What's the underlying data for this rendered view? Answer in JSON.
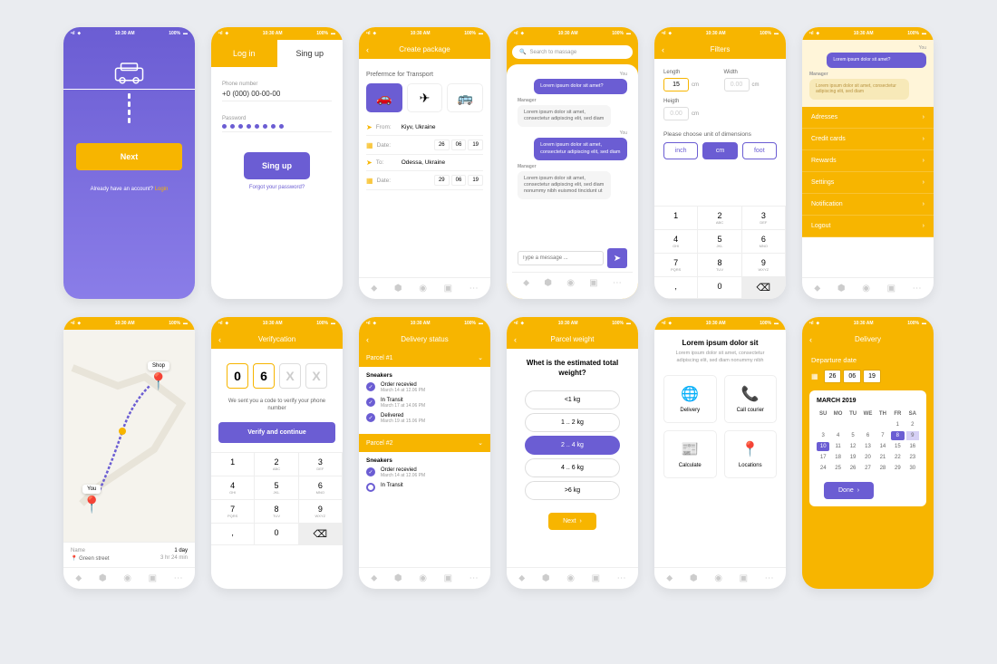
{
  "status": {
    "time": "10:30 AM",
    "battery": "100%"
  },
  "s1": {
    "next": "Next",
    "already": "Already have an account?",
    "login": "Login"
  },
  "s2": {
    "login": "Log in",
    "signup": "Sing up",
    "phone_lbl": "Phone number",
    "phone_val": "+0 (000) 00-00-00",
    "pass_lbl": "Password",
    "btn": "Sing up",
    "forgot": "Forgot your password?"
  },
  "s3": {
    "title": "Create package",
    "pref": "Prefermce for Transport",
    "from_lbl": "From:",
    "from_val": "Kiyv, Ukraine",
    "date_lbl": "Date:",
    "d1": [
      "26",
      "06",
      "19"
    ],
    "to_lbl": "To:",
    "to_val": "Odessa, Ukraine",
    "d2": [
      "29",
      "06",
      "19"
    ]
  },
  "s4": {
    "search_ph": "Search to massage",
    "you": "You",
    "mgr": "Manager",
    "b1": "Lorem ipsum dolor sit amet?",
    "b2": "Lorem ipsum dolor sit amet, consectetur adipiscing elit, sed diam",
    "b3": "Lorem ipsum dolor sit amet, consectetur adipiscing elit, sed diam",
    "b4": "Lorem ipsum dolor sit amet, consectetur adipiscing elit, sed diam nonummy nibh euismod tincidunt ut",
    "msg_ph": "Type a message ..."
  },
  "s5": {
    "title": "Filters",
    "length": "Length",
    "width": "Width",
    "height": "Heigth",
    "len_val": "15",
    "empty": "0.00",
    "cm": "cm",
    "unit_lbl": "Please choose unit of dimensions",
    "units": [
      "inch",
      "cm",
      "foot"
    ],
    "keys": [
      [
        "1",
        ""
      ],
      [
        "2",
        "ABC"
      ],
      [
        "3",
        "DEF"
      ],
      [
        "4",
        "GHI"
      ],
      [
        "5",
        "JKL"
      ],
      [
        "6",
        "MNO"
      ],
      [
        "7",
        "PQRS"
      ],
      [
        "8",
        "TUV"
      ],
      [
        "9",
        "WXYZ"
      ],
      [
        ",",
        ""
      ],
      [
        "0",
        ""
      ]
    ]
  },
  "s6": {
    "you": "You",
    "b1": "Lorem ipsum dolor sit amet?",
    "mgr": "Manager",
    "b2": "Lorem ipsum dolor sit amet, consectetur adipiscing elit, sed diam",
    "items": [
      "Adresses",
      "Credit cards",
      "Rewards",
      "Settings",
      "Notification",
      "Logout"
    ]
  },
  "s7": {
    "shop": "Shop",
    "you": "You",
    "name_lbl": "Name",
    "name_val": "Green street",
    "dur_lbl": "1 day",
    "dur_val": "3 hr   24 min"
  },
  "s8": {
    "title": "Verifycation",
    "d1": "0",
    "d2": "6",
    "ph": "X",
    "txt": "We sent you a code to verify your phone number",
    "btn": "Verify and continue",
    "keys": [
      [
        "1",
        ""
      ],
      [
        "2",
        "ABC"
      ],
      [
        "3",
        "DEF"
      ],
      [
        "4",
        "GHI"
      ],
      [
        "5",
        "JKL"
      ],
      [
        "6",
        "MNO"
      ],
      [
        "7",
        "PQRS"
      ],
      [
        "8",
        "TUV"
      ],
      [
        "9",
        "WXYZ"
      ],
      [
        ",",
        ""
      ],
      [
        "0",
        ""
      ]
    ]
  },
  "s9": {
    "title": "Delivery status",
    "p1": "Parcel #1",
    "p2": "Parcel #2",
    "cat": "Sneakers",
    "i1": "Order recevied",
    "i1d": "March 14 at 12.06 PM",
    "i2": "In Transit",
    "i2d": "March 17 at 14.06 PM",
    "i3": "Delivered",
    "i3d": "March 19 at 15.06 PM"
  },
  "s10": {
    "title": "Parcel weight",
    "q": "Whet is the estimated total weight?",
    "opts": [
      "<1 kg",
      "1 .. 2 kg",
      "2 .. 4 kg",
      "4 .. 6 kg",
      ">6 kg"
    ],
    "next": "Next"
  },
  "s11": {
    "h": "Lorem ipsum dolor sit",
    "p": "Lorem ipsum dolor sit amet, consectetur adipiscing elit, sed diam nonummy nibh",
    "items": [
      "Delivery",
      "Call courier",
      "Calculate",
      "Locations"
    ]
  },
  "s12": {
    "title": "Delivery",
    "dep": "Departure date",
    "date": [
      "26",
      "06",
      "19"
    ],
    "month": "MARCH 2019",
    "days": [
      "SU",
      "MO",
      "TU",
      "WE",
      "TH",
      "FR",
      "SA"
    ],
    "done": "Done"
  }
}
